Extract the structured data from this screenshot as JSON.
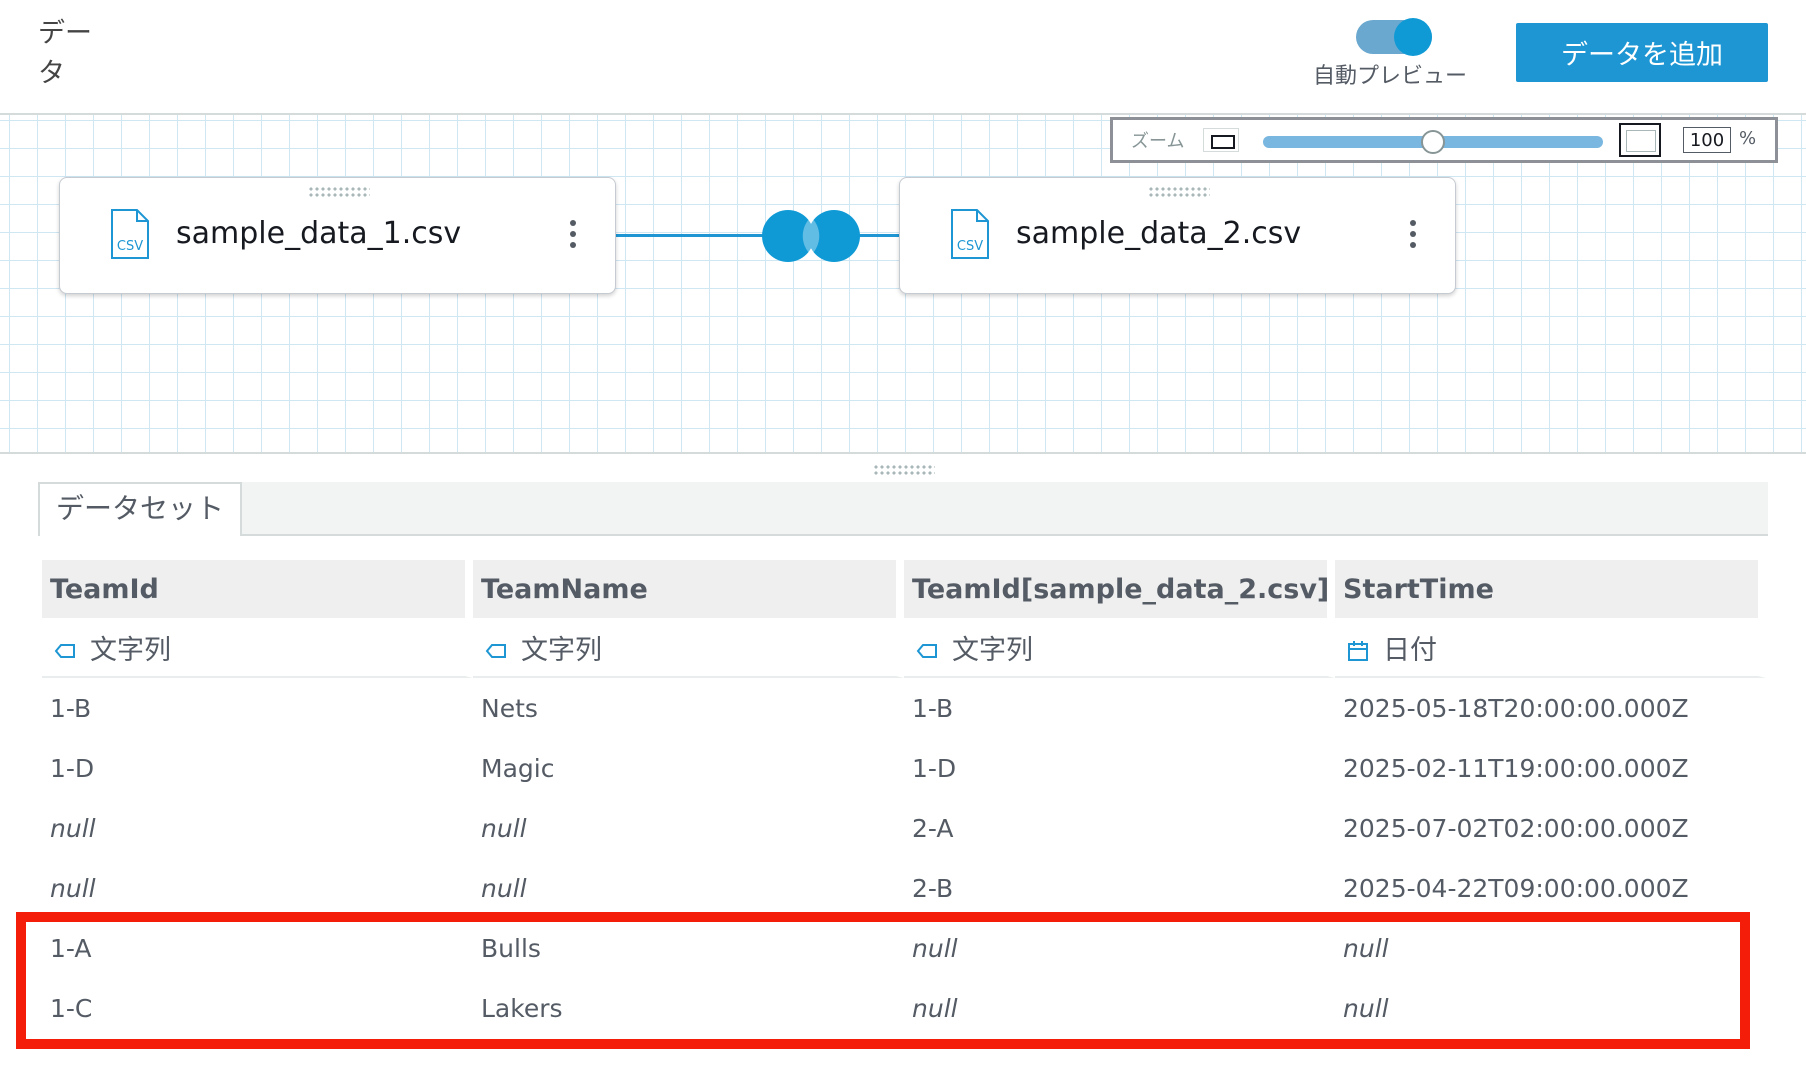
{
  "header": {
    "title": "データ",
    "auto_preview_label": "自動プレビュー",
    "auto_preview_on": true,
    "add_data_button": "データを追加",
    "accent_color": "#1d96d3"
  },
  "zoom": {
    "label": "ズーム",
    "value": "100",
    "unit": "%",
    "slider_fraction": 0.5
  },
  "canvas": {
    "nodes": [
      {
        "label": "sample_data_1.csv",
        "icon_text": "CSV",
        "icon": "csv-file-icon"
      },
      {
        "label": "sample_data_2.csv",
        "icon_text": "CSV",
        "icon": "csv-file-icon"
      }
    ],
    "join_icon": "join-icon"
  },
  "panel": {
    "tab_label": "データセット"
  },
  "table": {
    "columns": [
      {
        "name": "TeamId",
        "type": "文字列",
        "type_icon": "string-tag-icon"
      },
      {
        "name": "TeamName",
        "type": "文字列",
        "type_icon": "string-tag-icon"
      },
      {
        "name": "TeamId[sample_data_2.csv]",
        "type": "文字列",
        "type_icon": "string-tag-icon"
      },
      {
        "name": "StartTime",
        "type": "日付",
        "type_icon": "calendar-icon"
      }
    ],
    "rows": [
      [
        "1-B",
        "Nets",
        "1-B",
        "2025-05-18T20:00:00.000Z"
      ],
      [
        "1-D",
        "Magic",
        "1-D",
        "2025-02-11T19:00:00.000Z"
      ],
      [
        "null",
        "null",
        "2-A",
        "2025-07-02T02:00:00.000Z"
      ],
      [
        "null",
        "null",
        "2-B",
        "2025-04-22T09:00:00.000Z"
      ],
      [
        "1-A",
        "Bulls",
        "null",
        "null"
      ],
      [
        "1-C",
        "Lakers",
        "null",
        "null"
      ]
    ],
    "highlighted_rows": [
      4,
      5
    ],
    "highlight_color": "#f41d0a"
  }
}
